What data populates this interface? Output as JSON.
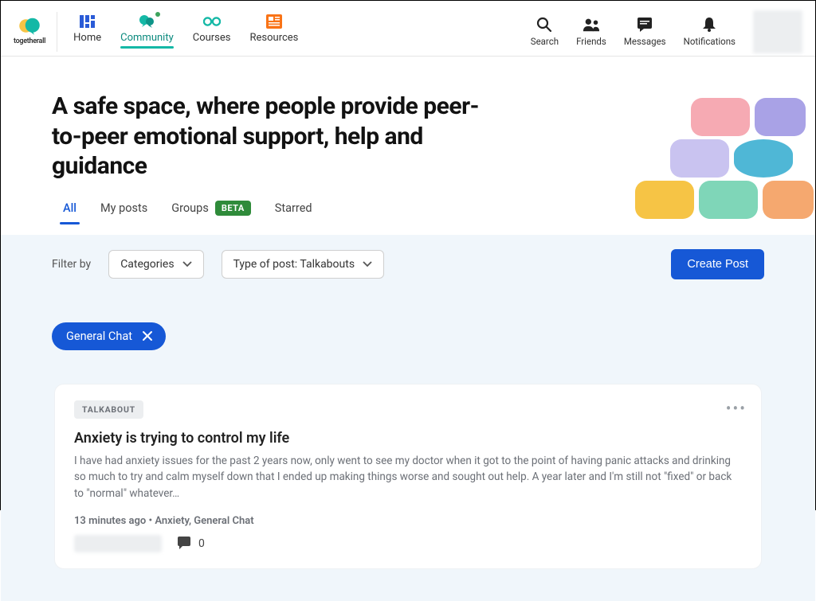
{
  "brand": {
    "name": "togetherall"
  },
  "nav": {
    "home": "Home",
    "community": "Community",
    "courses": "Courses",
    "resources": "Resources"
  },
  "top_right": {
    "search": "Search",
    "friends": "Friends",
    "messages": "Messages",
    "notifications": "Notifications"
  },
  "hero": {
    "title": "A safe space, where people provide peer-to-peer emotional support, help and guidance"
  },
  "tabs": {
    "all": "All",
    "my_posts": "My posts",
    "groups": "Groups",
    "beta": "BETA",
    "starred": "Starred"
  },
  "filter": {
    "label": "Filter by",
    "categories": "Categories",
    "type_of_post": "Type of post: Talkabouts",
    "create": "Create Post"
  },
  "chips": {
    "general_chat": "General Chat"
  },
  "post": {
    "badge": "TALKABOUT",
    "title": "Anxiety is trying to control my life",
    "body": "I have had anxiety issues for the past 2 years now, only went to see my doctor when it got to the point of having panic attacks and drinking so much to try and calm myself down that I ended up making things worse and sought out help. A year later and I'm still not \"fixed\" or back to \"normal\" whatever…",
    "meta": "13 minutes ago • Anxiety, General Chat",
    "comments": "0"
  }
}
